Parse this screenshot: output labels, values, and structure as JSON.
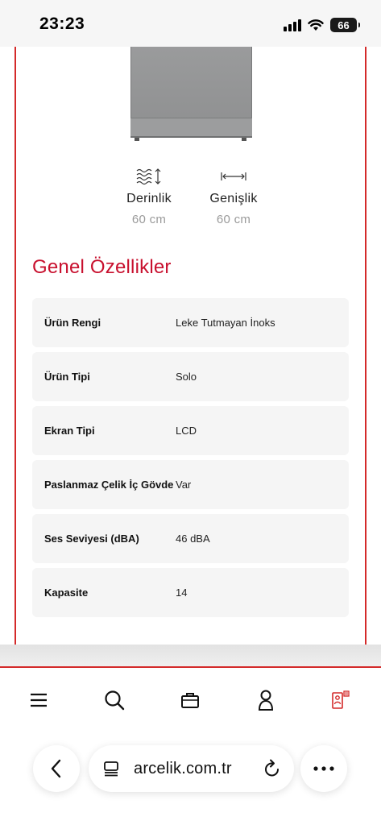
{
  "status_bar": {
    "time": "23:23",
    "battery": "66"
  },
  "dimensions": [
    {
      "label": "Derinlik",
      "value": "60 cm",
      "icon": "depth-icon"
    },
    {
      "label": "Genişlik",
      "value": "60 cm",
      "icon": "width-icon"
    }
  ],
  "section_title": "Genel Özellikler",
  "specs": [
    {
      "name": "Ürün Rengi",
      "value": "Leke Tutmayan İnoks"
    },
    {
      "name": "Ürün Tipi",
      "value": "Solo"
    },
    {
      "name": "Ekran Tipi",
      "value": "LCD"
    },
    {
      "name": "Paslanmaz Çelik İç Gövde",
      "value": "Var"
    },
    {
      "name": "Ses Seviyesi (dBA)",
      "value": "46 dBA"
    },
    {
      "name": "Kapasite",
      "value": "14"
    }
  ],
  "bottom_nav": [
    "menu-icon",
    "search-icon",
    "briefcase-icon",
    "user-icon",
    "compare-icon"
  ],
  "browser": {
    "url": "arcelik.com.tr"
  },
  "colors": {
    "accent": "#c8102e",
    "border": "#d42a2a",
    "row_bg": "#f5f5f5",
    "muted": "#9a9a9a"
  }
}
